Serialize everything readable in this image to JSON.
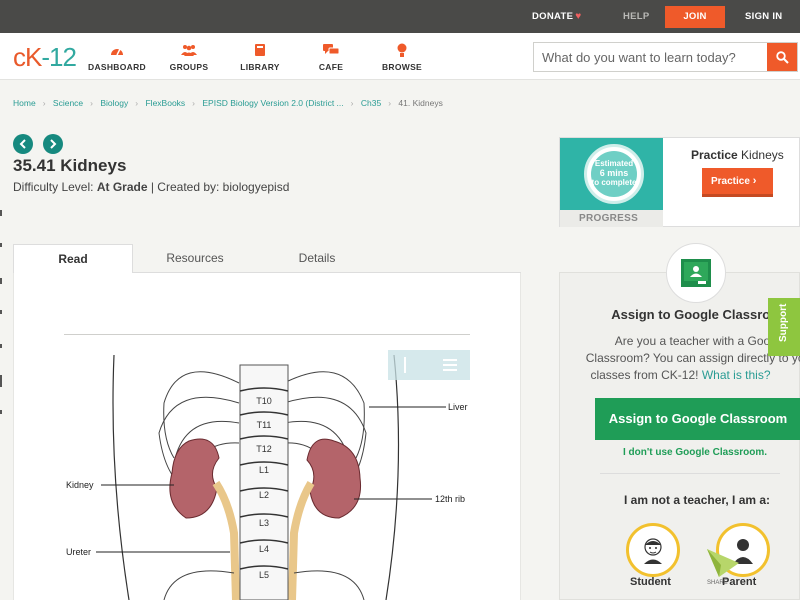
{
  "topbar": {
    "donate": "DONATE",
    "help": "HELP",
    "join": "JOIN",
    "signin": "SIGN IN"
  },
  "logo": {
    "c": "c",
    "k": "K",
    "dash": "-",
    "n": "12"
  },
  "nav": [
    {
      "label": "DASHBOARD",
      "icon": "dashboard-icon"
    },
    {
      "label": "GROUPS",
      "icon": "groups-icon"
    },
    {
      "label": "LIBRARY",
      "icon": "library-icon"
    },
    {
      "label": "CAFE",
      "icon": "cafe-icon"
    },
    {
      "label": "BROWSE",
      "icon": "browse-icon"
    }
  ],
  "search": {
    "placeholder": "What do you want to learn today?"
  },
  "breadcrumb": [
    "Home",
    "Science",
    "Biology",
    "FlexBooks",
    "EPISD Biology Version 2.0 (District ...",
    "Ch35",
    "41. Kidneys"
  ],
  "article": {
    "title": "35.41 Kidneys",
    "difficulty_label": "Difficulty Level:",
    "difficulty_value": "At Grade",
    "created": "| Created by: biologyepisd"
  },
  "tabs": [
    "Read",
    "Resources",
    "Details"
  ],
  "figure": {
    "labels": [
      "T10",
      "T11",
      "T12",
      "L1",
      "L2",
      "L3",
      "L4",
      "L5"
    ],
    "liver": "Liver",
    "kidney": "Kidney",
    "rib": "12th rib",
    "ureter": "Ureter"
  },
  "practice": {
    "ring_line1": "Estimated",
    "ring_line2": "6 mins",
    "ring_line3": "to complete",
    "progress": "PROGRESS",
    "title_bold": "Practice",
    "title_rest": "Kidneys",
    "button": "Practice"
  },
  "classroom": {
    "title": "Assign to Google Classroom",
    "text_line1": "Are you a teacher with a Google",
    "text_line2": "Classroom? You can assign directly to your",
    "text_line3": "classes from CK-12!",
    "link": "What is this?",
    "button": "Assign to Google Classroom",
    "no_link": "I don't use Google Classroom.",
    "not_teacher": "I am not a teacher, I am a:",
    "student": "Student",
    "parent": "Parent"
  },
  "support": "Support",
  "share": "SHARE"
}
